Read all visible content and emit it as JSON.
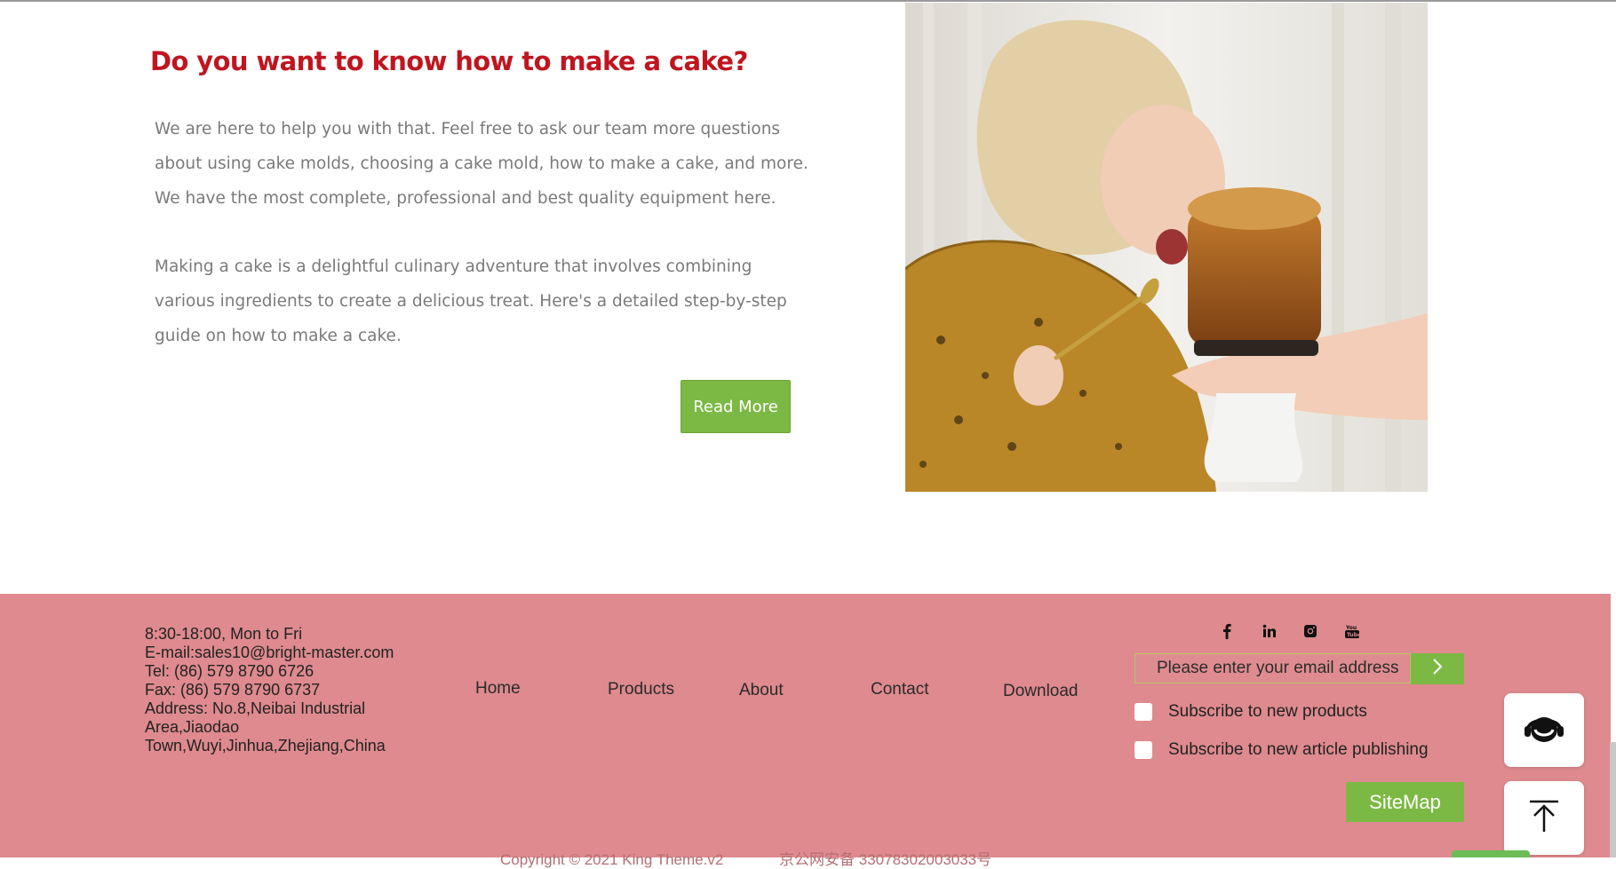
{
  "hero": {
    "title": "Do you want to know how to make a cake?",
    "paragraph1": "We are here to help you with that. Feel free to ask our team more questions about using cake molds, choosing a cake mold, how to make a cake, and more. We have the most complete, professional and best quality equipment here.",
    "paragraph2": "Making a cake is a delightful culinary adventure that involves combining various ingredients to create a delicious treat. Here's a detailed step-by-step guide on how to make a cake.",
    "read_more_label": "Read More",
    "image_icon": "child-eating-cake-photo"
  },
  "footer": {
    "contact": {
      "hours": "8:30-18:00, Mon to Fri",
      "email": "E-mail:sales10@bright-master.com",
      "tel": "Tel: (86) 579 8790 6726",
      "fax": "Fax: (86) 579 8790 6737",
      "address_line1": "Address: No.8,Neibai Industrial",
      "address_line2": "Area,Jiaodao",
      "address_line3": "Town,Wuyi,Jinhua,Zhejiang,China"
    },
    "nav": {
      "home": "Home",
      "products": "Products",
      "about": "About",
      "contact": "Contact",
      "download": "Download"
    },
    "social_icons": [
      "facebook-icon",
      "linkedin-icon",
      "instagram-icon",
      "youtube-icon"
    ],
    "subscribe": {
      "placeholder": "Please enter your email address",
      "submit_icon": "chevron-right-icon",
      "option_products": "Subscribe to new products",
      "option_articles": "Subscribe to new article publishing"
    },
    "sitemap_label": "SiteMap",
    "copyright": "Copyright © 2021 King Theme.v2",
    "beian": "京公网安备 33078302003033号"
  },
  "floating": {
    "support_icon": "customer-service-headset-icon",
    "top_icon": "arrow-up-to-top-icon"
  },
  "colors": {
    "title_red": "#c0151f",
    "accent_green": "#7cb944",
    "footer_pink": "#de8a8e",
    "body_text_gray": "#7a7a7a"
  }
}
